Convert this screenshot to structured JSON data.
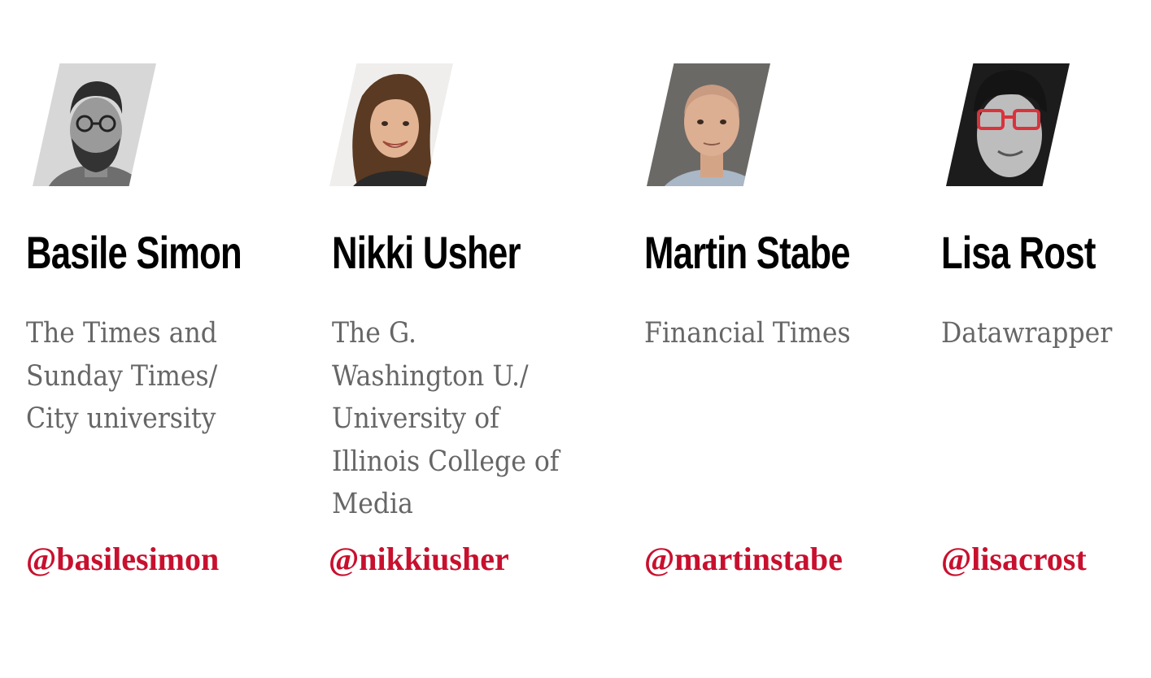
{
  "accent_color": "#c8102e",
  "speakers": [
    {
      "name": "Basile Simon",
      "affiliation": "The Times and Sunday Times/ City university",
      "handle": "@basilesimon",
      "photo": "avatar"
    },
    {
      "name": "Nikki Usher",
      "affiliation": "The G. Washington U./ University of Illinois College of Media",
      "handle": "@nikkiusher",
      "photo": "avatar"
    },
    {
      "name": "Martin Stabe",
      "affiliation": "Financial Times",
      "handle": "@martinstabe",
      "photo": "avatar"
    },
    {
      "name": "Lisa Rost",
      "affiliation": "Datawrapper",
      "handle": "@lisacrost",
      "photo": "avatar"
    }
  ]
}
